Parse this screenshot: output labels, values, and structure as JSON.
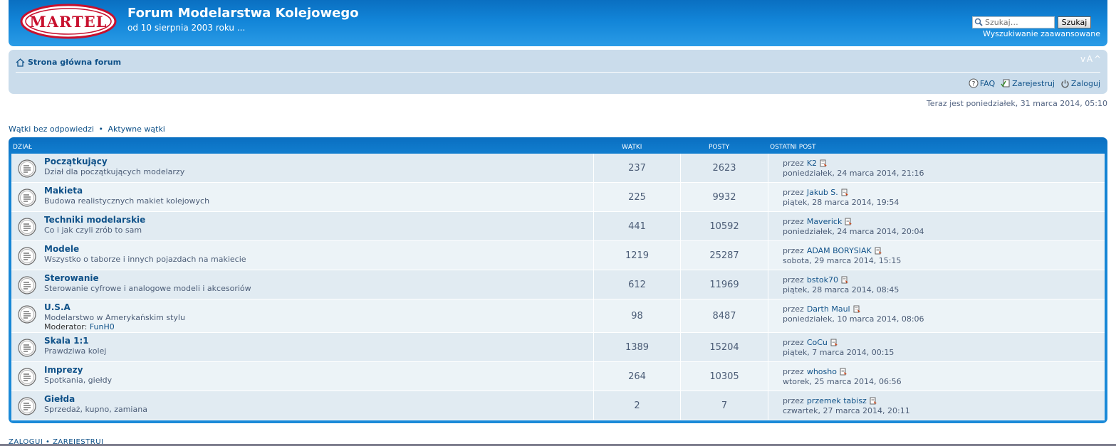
{
  "header": {
    "logo_text": "MARTEL",
    "title": "Forum Modelarstwa Kolejowego",
    "description": "od 10 sierpnia 2003 roku ...",
    "search_placeholder": "Szukaj…",
    "search_button": "Szukaj",
    "advanced_search": "Wyszukiwanie zaawansowane"
  },
  "navbar": {
    "home": "Strona główna forum",
    "font_size_control": "v A ^",
    "faq": "FAQ",
    "register": "Zarejestruj",
    "login": "Zaloguj"
  },
  "current_time": "Teraz jest poniedziałek, 31 marca 2014, 05:10",
  "quick_links": {
    "unanswered": "Wątki bez odpowiedzi",
    "separator": "•",
    "active": "Aktywne wątki"
  },
  "forum_list": {
    "headers": {
      "forum": "DZIAŁ",
      "topics": "WĄTKI",
      "posts": "POSTY",
      "last_post": "OSTATNI POST"
    },
    "by_label": "przez",
    "moderator_label": "Moderator:",
    "rows": [
      {
        "title": "Początkujący",
        "description": "Dział dla początkujących modelarzy",
        "topics": "237",
        "posts": "2623",
        "last_author": "K2",
        "last_date": "poniedziałek, 24 marca 2014, 21:16"
      },
      {
        "title": "Makieta",
        "description": "Budowa realistycznych makiet kolejowych",
        "topics": "225",
        "posts": "9932",
        "last_author": "Jakub S.",
        "last_date": "piątek, 28 marca 2014, 19:54"
      },
      {
        "title": "Techniki modelarskie",
        "description": "Co i jak czyli zrób to sam",
        "topics": "441",
        "posts": "10592",
        "last_author": "Maverick",
        "last_date": "poniedziałek, 24 marca 2014, 20:04"
      },
      {
        "title": "Modele",
        "description": "Wszystko o taborze i innych pojazdach na makiecie",
        "topics": "1219",
        "posts": "25287",
        "last_author": "ADAM BORYSIAK",
        "last_date": "sobota, 29 marca 2014, 15:15"
      },
      {
        "title": "Sterowanie",
        "description": "Sterowanie cyfrowe i analogowe modeli i akcesoriów",
        "topics": "612",
        "posts": "11969",
        "last_author": "bstok70",
        "last_date": "piątek, 28 marca 2014, 08:45"
      },
      {
        "title": "U.S.A",
        "description": "Modelarstwo w Amerykańskim stylu",
        "moderator": "FunH0",
        "topics": "98",
        "posts": "8487",
        "last_author": "Darth Maul",
        "last_date": "poniedziałek, 10 marca 2014, 08:06"
      },
      {
        "title": "Skala 1:1",
        "description": "Prawdziwa kolej",
        "topics": "1389",
        "posts": "15204",
        "last_author": "CoCu",
        "last_date": "piątek, 7 marca 2014, 00:15"
      },
      {
        "title": "Imprezy",
        "description": "Spotkania, giełdy",
        "topics": "264",
        "posts": "10305",
        "last_author": "whosho",
        "last_date": "wtorek, 25 marca 2014, 06:56"
      },
      {
        "title": "Giełda",
        "description": "Sprzedaż, kupno, zamiana",
        "topics": "2",
        "posts": "7",
        "last_author": "przemek tabisz",
        "last_date": "czwartek, 27 marca 2014, 20:11"
      }
    ]
  },
  "footer": {
    "login": "ZALOGUJ",
    "separator": "•",
    "register": "ZAREJESTRUJ"
  },
  "colors": {
    "header_blue": "#1285d8",
    "navbar_bg": "#cadceb",
    "row_bg": "#e1ebf2",
    "row_alt_bg": "#ecf3f7",
    "link": "#105289"
  }
}
